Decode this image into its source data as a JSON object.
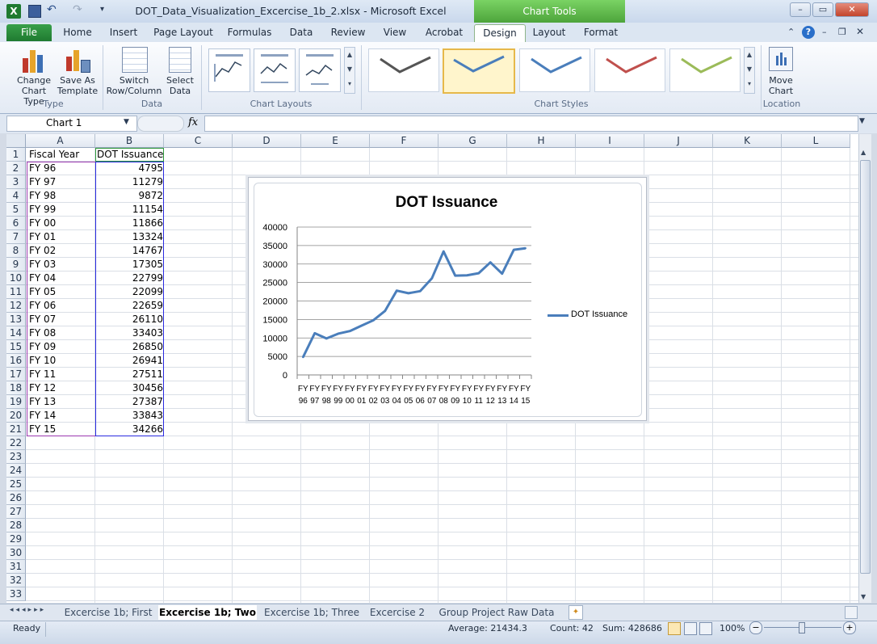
{
  "window": {
    "title": "DOT_Data_Visualization_Excercise_1b_2.xlsx - Microsoft Excel",
    "context_tools": "Chart Tools",
    "controls": [
      "–",
      "▭",
      "✕"
    ]
  },
  "ribbon_tabs": [
    "File",
    "Home",
    "Insert",
    "Page Layout",
    "Formulas",
    "Data",
    "Review",
    "View",
    "Acrobat",
    "Design",
    "Layout",
    "Format"
  ],
  "ribbon": {
    "type_group": {
      "label": "Type",
      "buttons": [
        {
          "line1": "Change",
          "line2": "Chart Type"
        },
        {
          "line1": "Save As",
          "line2": "Template"
        }
      ]
    },
    "data_group": {
      "label": "Data",
      "buttons": [
        {
          "line1": "Switch",
          "line2": "Row/Column"
        },
        {
          "line1": "Select",
          "line2": "Data"
        }
      ]
    },
    "layouts_group": {
      "label": "Chart Layouts"
    },
    "styles_group": {
      "label": "Chart Styles",
      "style_colors": [
        "#555555",
        "#4a7ebb",
        "#4a7ebb",
        "#c0504d",
        "#9bbb59"
      ]
    },
    "location_group": {
      "label": "Location",
      "button": {
        "line1": "Move",
        "line2": "Chart"
      }
    }
  },
  "formula_bar": {
    "name_box": "Chart 1",
    "fx": "fx",
    "value": ""
  },
  "columns": [
    "A",
    "B",
    "C",
    "D",
    "E",
    "F",
    "G",
    "H",
    "I",
    "J",
    "K",
    "L"
  ],
  "rows": [
    1,
    2,
    3,
    4,
    5,
    6,
    7,
    8,
    9,
    10,
    11,
    12,
    13,
    14,
    15,
    16,
    17,
    18,
    19,
    20,
    21,
    22,
    23,
    24,
    25,
    26,
    27,
    28,
    29,
    30,
    31,
    32,
    33
  ],
  "sheet": {
    "header": [
      "Fiscal Year",
      "DOT Issuance"
    ],
    "data": [
      [
        "FY 96",
        "4795"
      ],
      [
        "FY 97",
        "11279"
      ],
      [
        "FY 98",
        "9872"
      ],
      [
        "FY 99",
        "11154"
      ],
      [
        "FY 00",
        "11866"
      ],
      [
        "FY 01",
        "13324"
      ],
      [
        "FY 02",
        "14767"
      ],
      [
        "FY 03",
        "17305"
      ],
      [
        "FY 04",
        "22799"
      ],
      [
        "FY 05",
        "22099"
      ],
      [
        "FY 06",
        "22659"
      ],
      [
        "FY 07",
        "26110"
      ],
      [
        "FY 08",
        "33403"
      ],
      [
        "FY 09",
        "26850"
      ],
      [
        "FY 10",
        "26941"
      ],
      [
        "FY 11",
        "27511"
      ],
      [
        "FY 12",
        "30456"
      ],
      [
        "FY 13",
        "27387"
      ],
      [
        "FY 14",
        "33843"
      ],
      [
        "FY 15",
        "34266"
      ]
    ]
  },
  "chart_data": {
    "type": "line",
    "title": "DOT Issuance",
    "categories": [
      "FY 96",
      "FY 97",
      "FY 98",
      "FY 99",
      "FY 00",
      "FY 01",
      "FY 02",
      "FY 03",
      "FY 04",
      "FY 05",
      "FY 06",
      "FY 07",
      "FY 08",
      "FY 09",
      "FY 10",
      "FY 11",
      "FY 12",
      "FY 13",
      "FY 14",
      "FY 15"
    ],
    "tick_labels_top": [
      "FY",
      "FY",
      "FY",
      "FY",
      "FY",
      "FY",
      "FY",
      "FY",
      "FY",
      "FY",
      "FY",
      "FY",
      "FY",
      "FY",
      "FY",
      "FY",
      "FY",
      "FY",
      "FY",
      "FY"
    ],
    "tick_labels_bottom": [
      "96",
      "97",
      "98",
      "99",
      "00",
      "01",
      "02",
      "03",
      "04",
      "05",
      "06",
      "07",
      "08",
      "09",
      "10",
      "11",
      "12",
      "13",
      "14",
      "15"
    ],
    "series": [
      {
        "name": "DOT Issuance",
        "color": "#4a7ebb",
        "values": [
          4795,
          11279,
          9872,
          11154,
          11866,
          13324,
          14767,
          17305,
          22799,
          22099,
          22659,
          26110,
          33403,
          26850,
          26941,
          27511,
          30456,
          27387,
          33843,
          34266
        ]
      }
    ],
    "ylim": [
      0,
      40000
    ],
    "yticks": [
      0,
      5000,
      10000,
      15000,
      20000,
      25000,
      30000,
      35000,
      40000
    ],
    "grid": true,
    "legend": "right"
  },
  "sheet_tabs": [
    "Excercise 1b; First",
    "Excercise 1b; Two",
    "Excercise 1b; Three",
    "Excercise 2",
    "Group Project Raw Data"
  ],
  "active_sheet": "Excercise 1b; Two",
  "status": {
    "mode": "Ready",
    "average": "Average: 21434.3",
    "count": "Count: 42",
    "sum": "Sum: 428686",
    "zoom": "100%"
  }
}
